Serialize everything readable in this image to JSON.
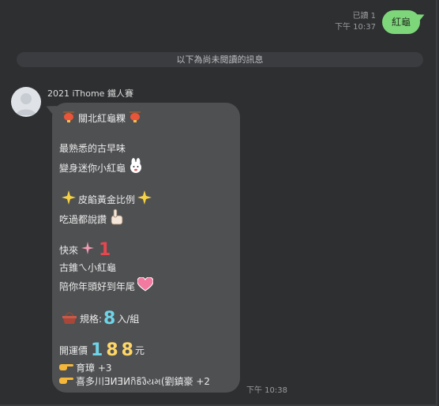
{
  "outgoing": {
    "read_status": "已讀 1",
    "time": "下午 10:37",
    "text": "紅龜"
  },
  "divider": {
    "text": "以下為尚未閱讀的訊息"
  },
  "incoming": {
    "sender": "2021 iThome 鐵人賽",
    "time": "下午 10:38",
    "lines": {
      "l1": "關北紅龜粿",
      "l2": "最熟悉的古早味",
      "l3": "變身迷你小紅龜",
      "l4": "皮餡黃金比例",
      "l5": "吃過都說讚",
      "l6": "快來",
      "l6_num": "1",
      "l7": "古錐ㄟ小紅龜",
      "l8": "陪你年頭好到年尾",
      "l9a": "規格:",
      "l9_num": "8",
      "l9b": "入/組",
      "l10a": "開運價",
      "l10_d1": "1",
      "l10_d2": "8",
      "l10_d3": "8",
      "l10b": "元",
      "l11": "育璋 +3",
      "l12": "喜多川ƎИƎИกิธิงิયમ(劉鎮豪 +2"
    }
  },
  "colors": {
    "background": "#2d2f31",
    "out_bubble": "#7ed67a",
    "in_bubble": "#4f5052",
    "divider": "#3a3c3f",
    "digit_red": "#e8474f",
    "digit_cyan": "#6fd4e8",
    "digit_yellow": "#ffd766"
  },
  "icons": [
    "lantern-icon",
    "rabbit-emoji-icon",
    "sparkle-icon",
    "thumbs-up-icon",
    "plus-icon",
    "heart-icon",
    "basket-icon",
    "pointing-hand-icon"
  ]
}
